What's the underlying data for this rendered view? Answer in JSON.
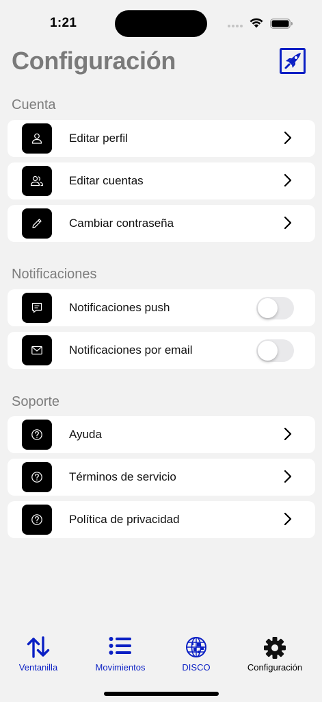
{
  "status_bar": {
    "time": "1:21"
  },
  "header": {
    "title": "Configuración"
  },
  "sections": {
    "cuenta": {
      "title": "Cuenta",
      "items": [
        {
          "label": "Editar perfil"
        },
        {
          "label": "Editar cuentas"
        },
        {
          "label": "Cambiar contraseña"
        }
      ]
    },
    "notificaciones": {
      "title": "Notificaciones",
      "items": [
        {
          "label": "Notificaciones push",
          "enabled": false
        },
        {
          "label": "Notificaciones por email",
          "enabled": false
        }
      ]
    },
    "soporte": {
      "title": "Soporte",
      "items": [
        {
          "label": "Ayuda"
        },
        {
          "label": "Términos de servicio"
        },
        {
          "label": "Política de privacidad"
        }
      ]
    }
  },
  "tab_bar": {
    "tabs": [
      {
        "label": "Ventanilla",
        "icon": "arrows-up-down-icon"
      },
      {
        "label": "Movimientos",
        "icon": "list-icon"
      },
      {
        "label": "DISCO",
        "icon": "globe-icon"
      },
      {
        "label": "Configuración",
        "icon": "gear-icon",
        "active": true
      }
    ]
  },
  "colors": {
    "accent": "#0a1fc4",
    "background": "#f2f2f2",
    "title_gray": "#7a7a7a",
    "toggle_off": "#e9e9eb"
  }
}
